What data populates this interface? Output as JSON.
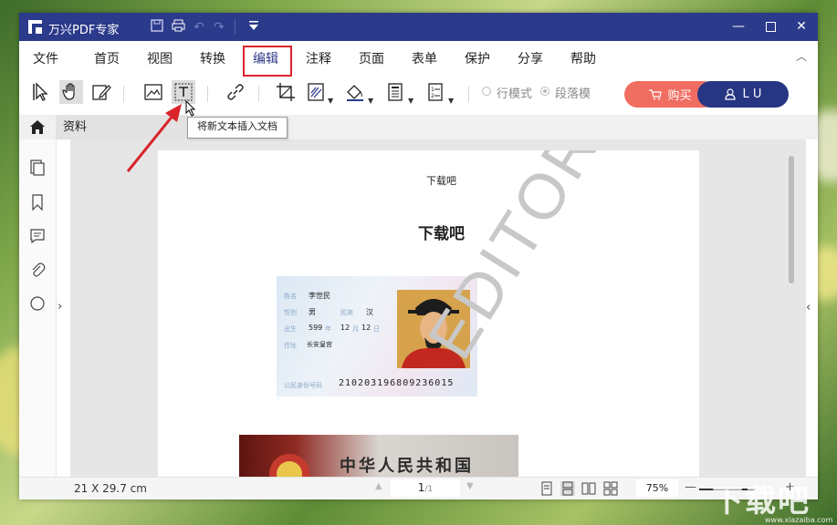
{
  "app": {
    "title": "万兴PDF专家"
  },
  "menu": [
    "文件",
    "首页",
    "视图",
    "转换",
    "编辑",
    "注释",
    "页面",
    "表单",
    "保护",
    "分享",
    "帮助"
  ],
  "active_menu": "编辑",
  "toolbar": {
    "mode_line": "行模式",
    "mode_paragraph": "段落模",
    "buy_label": "购买",
    "user_label": "L U",
    "tooltip": "将新文本插入文档"
  },
  "tabs": {
    "doc": "资料"
  },
  "document": {
    "header": "下载吧",
    "heading": "下载吧",
    "watermark": "EDITOR",
    "id_card": {
      "name_label": "姓名",
      "name": "李世民",
      "gender_label": "性别",
      "gender": "男",
      "ethnic_label": "民族",
      "ethnic": "汉",
      "birth_label": "出生",
      "birth_year": "599",
      "birth_month": "12",
      "birth_day": "12",
      "year_unit": "年",
      "month_unit": "月",
      "day_unit": "日",
      "address_label": "住址",
      "address": "长安皇宫",
      "number_label": "公民身份号码",
      "number": "210203196809236015"
    },
    "id_back_title": "中华人民共和国"
  },
  "status": {
    "dims": "21 X 29.7 cm",
    "page_current": "1",
    "page_total": "/1",
    "zoom": "75%"
  },
  "overlay": {
    "site_mark": "下载吧",
    "site_url": "www.xiazaiba.com"
  },
  "colors": {
    "titlebar": "#2b3a8a",
    "buy": "#f06d61",
    "user": "#263683",
    "highlight": "#d9242a"
  }
}
